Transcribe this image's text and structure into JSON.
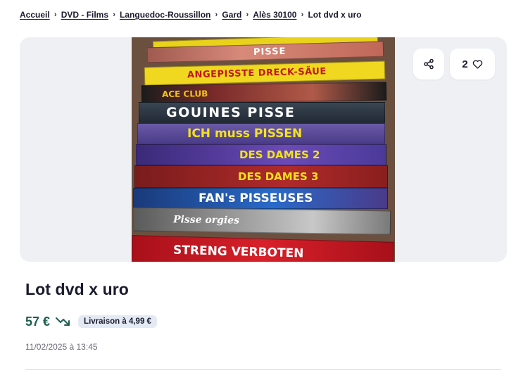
{
  "breadcrumb": {
    "items": [
      "Accueil",
      "DVD - Films",
      "Languedoc-Roussillon",
      "Gard",
      "Alès 30100"
    ],
    "current": "Lot dvd x uro"
  },
  "gallery": {
    "favorite_count": "2",
    "photo_spines": [
      "PISSE",
      "ANGEPISSTE DRECK-SÄUE",
      "ACE CLUB",
      "GOUINES PISSE",
      "ICH muss PISSEN",
      "DES DAMES 2",
      "DES DAMES 3",
      "FAN's PISSEUSES",
      "Pisse orgies",
      "STRENG VERBOTEN"
    ]
  },
  "listing": {
    "title": "Lot dvd x uro",
    "price": "57 €",
    "delivery": "Livraison à 4,99 €",
    "date": "11/02/2025 à 13:45"
  },
  "colors": {
    "price": "#1f5e4e",
    "badge_bg": "#e4eaf3",
    "gallery_bg": "#eef0f4"
  },
  "icons": {
    "breadcrumb_separator": "chevron-right-icon",
    "share": "share-icon",
    "favorite": "heart-icon",
    "price_trend": "trending-down-icon"
  }
}
